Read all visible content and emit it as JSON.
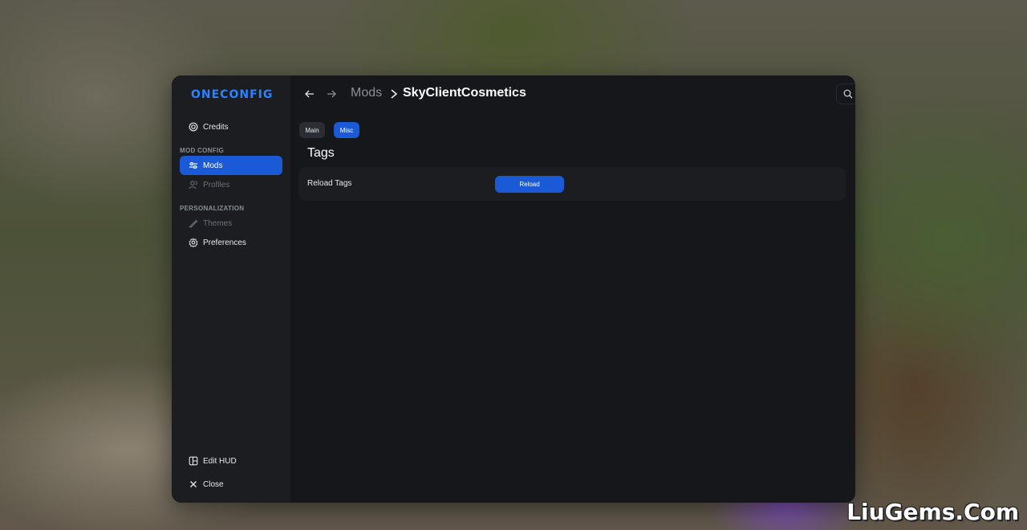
{
  "app": {
    "logo_text": "ONECONFIG",
    "accent_color": "#1a5ad6"
  },
  "sidebar": {
    "credits": {
      "label": "Credits",
      "icon": "credits-icon"
    },
    "mod_config_section": "MOD CONFIG",
    "mods": {
      "label": "Mods",
      "icon": "sliders-icon",
      "active": true
    },
    "profiles": {
      "label": "Profiles",
      "icon": "users-icon",
      "disabled": true
    },
    "personalization_section": "PERSONALIZATION",
    "themes": {
      "label": "Themes",
      "icon": "brush-icon",
      "disabled": true
    },
    "preferences": {
      "label": "Preferences",
      "icon": "gear-icon"
    },
    "edit_hud": {
      "label": "Edit HUD",
      "icon": "layout-icon"
    },
    "close": {
      "label": "Close",
      "icon": "close-icon"
    }
  },
  "header": {
    "breadcrumb_parent": "Mods",
    "breadcrumb_current": "SkyClientCosmetics",
    "search_placeholder": "Search..."
  },
  "tabs": [
    {
      "label": "Main",
      "active": false
    },
    {
      "label": "Misc",
      "active": true
    }
  ],
  "section": {
    "title": "Tags",
    "options": [
      {
        "label": "Reload Tags",
        "button_label": "Reload"
      }
    ]
  },
  "watermark": "LiuGems.Com"
}
